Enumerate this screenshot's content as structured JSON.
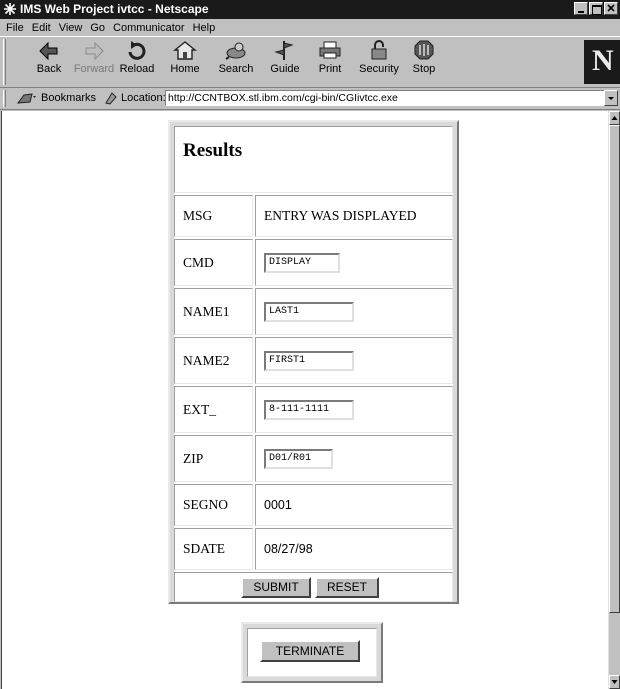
{
  "window": {
    "title": "IMS Web Project ivtcc - Netscape"
  },
  "menu": [
    "File",
    "Edit",
    "View",
    "Go",
    "Communicator",
    "Help"
  ],
  "toolbar": {
    "back": "Back",
    "forward": "Forward",
    "reload": "Reload",
    "home": "Home",
    "search": "Search",
    "guide": "Guide",
    "print": "Print",
    "security": "Security",
    "stop": "Stop",
    "logo": "N"
  },
  "location": {
    "bookmarks": "Bookmarks",
    "label": "Location:",
    "url": "http://CCNTBOX.stl.ibm.com/cgi-bin/CGIivtcc.exe"
  },
  "form": {
    "heading": "Results",
    "msg_label": "MSG",
    "msg_value": "ENTRY WAS DISPLAYED",
    "cmd_label": "CMD",
    "cmd_value": "DISPLAY",
    "name1_label": "NAME1",
    "name1_value": "LAST1",
    "name2_label": "NAME2",
    "name2_value": "FIRST1",
    "ext_label": "EXT_",
    "ext_value": "8-111-1111",
    "zip_label": "ZIP",
    "zip_value": "D01/R01",
    "segno_label": "SEGNO",
    "segno_value": "0001",
    "sdate_label": "SDATE",
    "sdate_value": "08/27/98",
    "submit": "SUBMIT",
    "reset": "RESET"
  },
  "terminate": "TERMINATE"
}
